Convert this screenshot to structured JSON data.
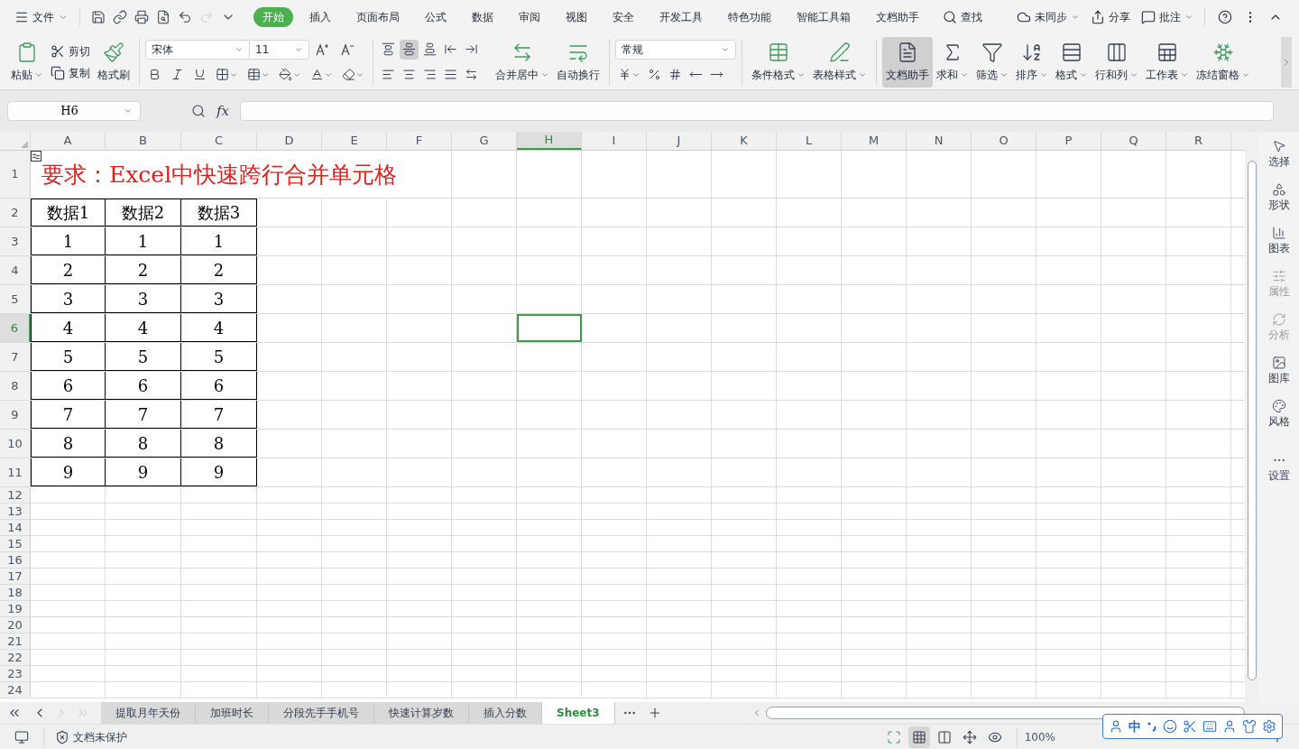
{
  "menu_bar": {
    "file": "文件",
    "tabs": [
      {
        "label": "开始",
        "selected": true
      },
      {
        "label": "插入",
        "selected": false
      },
      {
        "label": "页面布局",
        "selected": false
      },
      {
        "label": "公式",
        "selected": false
      },
      {
        "label": "数据",
        "selected": false
      },
      {
        "label": "审阅",
        "selected": false
      },
      {
        "label": "视图",
        "selected": false
      },
      {
        "label": "安全",
        "selected": false
      },
      {
        "label": "开发工具",
        "selected": false
      },
      {
        "label": "特色功能",
        "selected": false
      },
      {
        "label": "智能工具箱",
        "selected": false
      },
      {
        "label": "文档助手",
        "selected": false
      }
    ],
    "search": "查找",
    "sync": "未同步",
    "share": "分享",
    "comment": "批注"
  },
  "ribbon": {
    "clipboard": {
      "paste": "粘贴",
      "cut": "剪切",
      "copy": "复制",
      "format_painter": "格式刷"
    },
    "font": {
      "family": "宋体",
      "size": "11"
    },
    "alignment": {
      "buttons": [
        {
          "selected": false
        },
        {
          "selected": true
        },
        {
          "selected": false
        },
        {
          "selected": false
        },
        {
          "selected": false
        },
        {
          "selected": false
        },
        {
          "selected": false
        },
        {
          "selected": false
        },
        {
          "selected": false
        },
        {
          "selected": false
        }
      ],
      "merge": "合并居中",
      "wrap": "自动换行"
    },
    "number": {
      "format": "常规"
    },
    "styles": [
      {
        "label": "条件格式",
        "menu": true
      },
      {
        "label": "表格样式",
        "menu": true
      }
    ],
    "tools": [
      {
        "label": "文档助手",
        "selected": true,
        "menu": false
      },
      {
        "label": "求和",
        "selected": false,
        "menu": true
      },
      {
        "label": "筛选",
        "selected": false,
        "menu": true
      },
      {
        "label": "排序",
        "selected": false,
        "menu": true
      },
      {
        "label": "格式",
        "selected": false,
        "menu": true
      },
      {
        "label": "行和列",
        "selected": false,
        "menu": true
      },
      {
        "label": "工作表",
        "selected": false,
        "menu": true
      },
      {
        "label": "冻结窗格",
        "selected": false,
        "menu": true
      }
    ]
  },
  "formula_bar": {
    "name_box": "H6",
    "function_label": "fx"
  },
  "sheet": {
    "columns": [
      {
        "label": "A",
        "selected": false
      },
      {
        "label": "B",
        "selected": false
      },
      {
        "label": "C",
        "selected": false
      },
      {
        "label": "D",
        "selected": false
      },
      {
        "label": "E",
        "selected": false
      },
      {
        "label": "F",
        "selected": false
      },
      {
        "label": "G",
        "selected": false
      },
      {
        "label": "H",
        "selected": true
      },
      {
        "label": "I",
        "selected": false
      },
      {
        "label": "J",
        "selected": false
      },
      {
        "label": "K",
        "selected": false
      },
      {
        "label": "L",
        "selected": false
      },
      {
        "label": "M",
        "selected": false
      },
      {
        "label": "N",
        "selected": false
      },
      {
        "label": "O",
        "selected": false
      },
      {
        "label": "P",
        "selected": false
      },
      {
        "label": "Q",
        "selected": false
      },
      {
        "label": "R",
        "selected": false
      }
    ],
    "rows": [
      {
        "label": "1",
        "selected": false
      },
      {
        "label": "2",
        "selected": false
      },
      {
        "label": "3",
        "selected": false
      },
      {
        "label": "4",
        "selected": false
      },
      {
        "label": "5",
        "selected": false
      },
      {
        "label": "6",
        "selected": true
      },
      {
        "label": "7",
        "selected": false
      },
      {
        "label": "8",
        "selected": false
      },
      {
        "label": "9",
        "selected": false
      },
      {
        "label": "10",
        "selected": false
      },
      {
        "label": "11",
        "selected": false
      },
      {
        "label": "12",
        "selected": false
      },
      {
        "label": "13",
        "selected": false
      },
      {
        "label": "14",
        "selected": false
      },
      {
        "label": "15",
        "selected": false
      },
      {
        "label": "16",
        "selected": false
      },
      {
        "label": "17",
        "selected": false
      },
      {
        "label": "18",
        "selected": false
      },
      {
        "label": "19",
        "selected": false
      },
      {
        "label": "20",
        "selected": false
      },
      {
        "label": "21",
        "selected": false
      },
      {
        "label": "22",
        "selected": false
      },
      {
        "label": "23",
        "selected": false
      },
      {
        "label": "24",
        "selected": false
      }
    ],
    "title": "要求：Excel中快速跨行合并单元格",
    "table": {
      "header": [
        "数据1",
        "数据2",
        "数据3"
      ],
      "rows": [
        [
          "1",
          "1",
          "1"
        ],
        [
          "2",
          "2",
          "2"
        ],
        [
          "3",
          "3",
          "3"
        ],
        [
          "4",
          "4",
          "4"
        ],
        [
          "5",
          "5",
          "5"
        ],
        [
          "6",
          "6",
          "6"
        ],
        [
          "7",
          "7",
          "7"
        ],
        [
          "8",
          "8",
          "8"
        ],
        [
          "9",
          "9",
          "9"
        ]
      ]
    }
  },
  "side_panel": [
    {
      "label": "选择",
      "disabled": false
    },
    {
      "label": "形状",
      "disabled": false
    },
    {
      "label": "图表",
      "disabled": false
    },
    {
      "label": "属性",
      "disabled": true
    },
    {
      "label": "分析",
      "disabled": true
    },
    {
      "label": "图库",
      "disabled": false
    },
    {
      "label": "风格",
      "disabled": false
    },
    {
      "label": "设置",
      "disabled": false
    }
  ],
  "sheet_tabs": [
    {
      "label": "提取月年天份",
      "selected": false
    },
    {
      "label": "加班时长",
      "selected": false
    },
    {
      "label": "分段先手手机号",
      "selected": false
    },
    {
      "label": "快速计算岁数",
      "selected": false
    },
    {
      "label": "插入分数",
      "selected": false
    },
    {
      "label": "Sheet3",
      "selected": true
    }
  ],
  "status_bar": {
    "protection": "文档未保护",
    "zoom": "100%"
  },
  "ime_toolbar": {
    "mode": "中"
  }
}
